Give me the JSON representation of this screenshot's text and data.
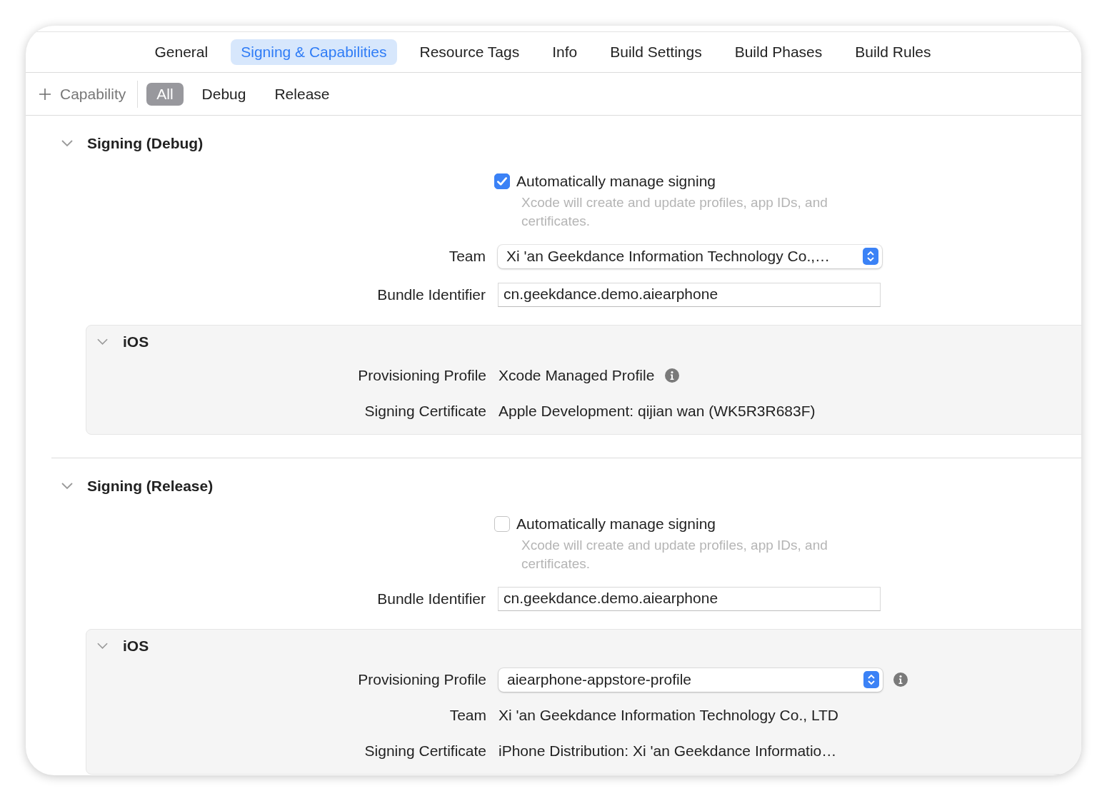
{
  "tabs": [
    {
      "label": "General",
      "selected": false
    },
    {
      "label": "Signing & Capabilities",
      "selected": true
    },
    {
      "label": "Resource Tags",
      "selected": false
    },
    {
      "label": "Info",
      "selected": false
    },
    {
      "label": "Build Settings",
      "selected": false
    },
    {
      "label": "Build Phases",
      "selected": false
    },
    {
      "label": "Build Rules",
      "selected": false
    }
  ],
  "toolbar": {
    "add_label": "Capability",
    "filters": [
      {
        "label": "All",
        "selected": true
      },
      {
        "label": "Debug",
        "selected": false
      },
      {
        "label": "Release",
        "selected": false
      }
    ]
  },
  "sections": [
    {
      "title": "Signing (Debug)",
      "expanded": true,
      "auto_signing": {
        "label": "Automatically manage signing",
        "checked": true,
        "hint": "Xcode will create and update profiles, app IDs, and certificates."
      },
      "fields": [
        {
          "kind": "popup",
          "label": "Team",
          "value": "Xi 'an Geekdance Information Technology Co.,…"
        },
        {
          "kind": "field",
          "label": "Bundle Identifier",
          "value": "cn.geekdance.demo.aiearphone"
        }
      ],
      "platform": {
        "title": "iOS",
        "expanded": true,
        "rows": [
          {
            "kind": "text",
            "label": "Provisioning Profile",
            "value": "Xcode Managed Profile",
            "info": true
          },
          {
            "kind": "text",
            "label": "Signing Certificate",
            "value": "Apple Development: qijian wan (WK5R3R683F)",
            "info": false
          }
        ]
      }
    },
    {
      "title": "Signing (Release)",
      "expanded": true,
      "auto_signing": {
        "label": "Automatically manage signing",
        "checked": false,
        "hint": "Xcode will create and update profiles, app IDs, and certificates."
      },
      "fields": [
        {
          "kind": "field",
          "label": "Bundle Identifier",
          "value": "cn.geekdance.demo.aiearphone"
        }
      ],
      "platform": {
        "title": "iOS",
        "expanded": true,
        "rows": [
          {
            "kind": "popup",
            "label": "Provisioning Profile",
            "value": "aiearphone-appstore-profile",
            "info": true
          },
          {
            "kind": "text",
            "label": "Team",
            "value": "Xi 'an Geekdance Information Technology Co., LTD",
            "info": false
          },
          {
            "kind": "text",
            "label": "Signing Certificate",
            "value": "iPhone Distribution: Xi 'an Geekdance Informatio…",
            "info": false
          }
        ]
      }
    }
  ]
}
